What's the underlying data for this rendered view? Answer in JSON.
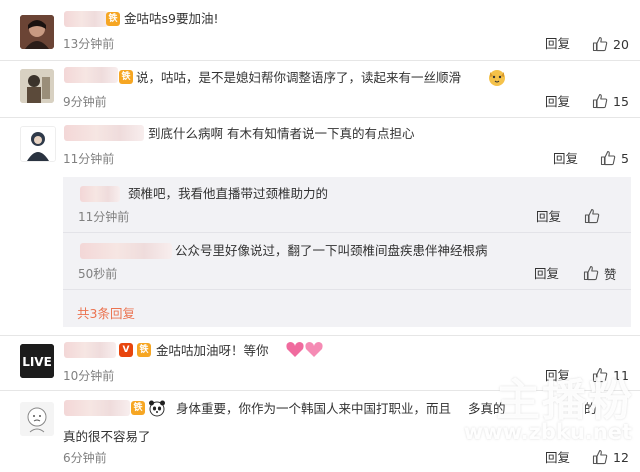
{
  "comments": [
    {
      "text": "金咕咕s9要加油!",
      "time": "13分钟前",
      "reply": "回复",
      "likes": "20"
    },
    {
      "text": "说，咕咕，是不是媳妇帮你调整语序了，读起来有一丝顺滑",
      "time": "9分钟前",
      "reply": "回复",
      "likes": "15"
    },
    {
      "text": "到底什么病啊 有木有知情者说一下真的有点担心",
      "time": "11分钟前",
      "reply": "回复",
      "likes": "5"
    },
    {
      "text": "金咕咕加油呀！等你",
      "time": "10分钟前",
      "reply": "回复",
      "likes": "11"
    },
    {
      "text_line1": "身体重要，你作为一个韩国人来中国打职业，而且",
      "text_line1_tail": "多真的",
      "text_line1_right": "的",
      "text_line2": "真的很不容易了",
      "time": "6分钟前",
      "reply": "回复",
      "likes": "12"
    }
  ],
  "sub_replies": [
    {
      "text": "颈椎吧，我看他直播带过颈椎助力的",
      "time": "11分钟前",
      "reply": "回复",
      "likes": ""
    },
    {
      "text": "公众号里好像说过，翻了一下叫颈椎间盘疾患伴神经根病",
      "time": "50秒前",
      "reply": "回复",
      "likes": "赞"
    }
  ],
  "more_replies": "共3条回复",
  "watermark": {
    "title": "主播粉",
    "url": "www.zbku.net"
  },
  "colors": {
    "accent": "#eb7350",
    "text": "#333333",
    "muted": "#808080",
    "sub_bg": "#f2f2f5",
    "badge_orange": "#f6a623",
    "badge_v": "#e8450d"
  }
}
